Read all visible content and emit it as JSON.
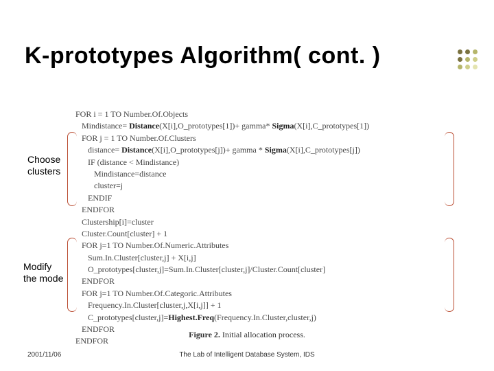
{
  "title": "K-prototypes Algorithm( cont. )",
  "labels": {
    "choose": "Choose\nclusters",
    "modify": "Modify\nthe mode"
  },
  "pseudocode": [
    {
      "indent": 0,
      "pre": "FOR i = 1 TO Number.Of.Objects"
    },
    {
      "indent": 1,
      "pre": "Mindistance= ",
      "bold": "Distance",
      "post": "(X[i],O_prototypes[1])+ gamma* ",
      "bold2": "Sigma",
      "post2": "(X[i],C_prototypes[1])"
    },
    {
      "indent": 1,
      "pre": "FOR j = 1 TO Number.Of.Clusters"
    },
    {
      "indent": 2,
      "pre": "distance= ",
      "bold": "Distance",
      "post": "(X[i],O_prototypes[j])+ gamma * ",
      "bold2": "Sigma",
      "post2": "(X[i],C_prototypes[j])"
    },
    {
      "indent": 2,
      "pre": "IF (distance < Mindistance)"
    },
    {
      "indent": 3,
      "pre": "Mindistance=distance"
    },
    {
      "indent": 3,
      "pre": "cluster=j"
    },
    {
      "indent": 2,
      "pre": "ENDIF"
    },
    {
      "indent": 1,
      "pre": "ENDFOR"
    },
    {
      "indent": 1,
      "pre": "Clustership[i]=cluster"
    },
    {
      "indent": 1,
      "pre": "Cluster.Count[cluster] + 1"
    },
    {
      "indent": 1,
      "pre": "FOR j=1 TO Number.Of.Numeric.Attributes"
    },
    {
      "indent": 2,
      "pre": "Sum.In.Cluster[cluster,j] + X[i,j]"
    },
    {
      "indent": 2,
      "pre": "O_prototypes[cluster,j]=Sum.In.Cluster[cluster,j]/Cluster.Count[cluster]"
    },
    {
      "indent": 1,
      "pre": "ENDFOR"
    },
    {
      "indent": 1,
      "pre": "FOR j=1 TO Number.Of.Categoric.Attributes"
    },
    {
      "indent": 2,
      "pre": "Frequency.In.Cluster[cluster,j,X[i,j]] + 1"
    },
    {
      "indent": 2,
      "pre": "C_prototypes[cluster,j]=",
      "bold": "Highest.Freq",
      "post": "(Frequency.In.Cluster,cluster,j)"
    },
    {
      "indent": 1,
      "pre": "ENDFOR"
    },
    {
      "indent": 0,
      "pre": "ENDFOR"
    }
  ],
  "caption": "Figure 2. Initial allocation process.",
  "caption_bold": "Figure 2.",
  "caption_rest": " Initial allocation process.",
  "footer": {
    "date": "2001/11/06",
    "lab": "The Lab of Intelligent Database System, IDS"
  },
  "dots": [
    [
      "#7a7240",
      "#7a7240",
      "#b5b56a"
    ],
    [
      "#7a7240",
      "#b5b56a",
      "#cfcf8a"
    ],
    [
      "#b5b56a",
      "#cfcf8a",
      "#e4e4b0"
    ]
  ]
}
